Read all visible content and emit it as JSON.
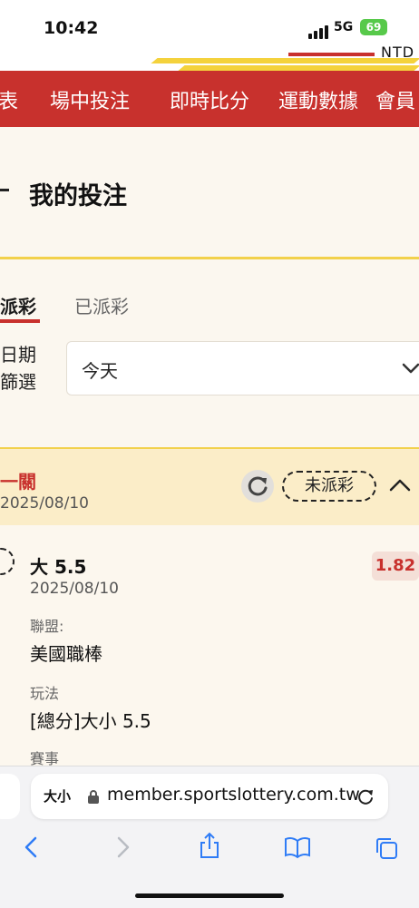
{
  "status_bar": {
    "time": "10:42",
    "network": "5G",
    "battery": "69"
  },
  "header": {
    "currency": "NTD"
  },
  "nav": {
    "items": [
      "表",
      "場中投注",
      "即時比分",
      "運動數據",
      "會員"
    ]
  },
  "page": {
    "title": "我的投注"
  },
  "tabs": {
    "unsettled": "派彩",
    "settled": "已派彩"
  },
  "filter": {
    "label_line1": "日期",
    "label_line2": "篩選",
    "selected": "今天"
  },
  "bet": {
    "type": "一關",
    "date": "2025/08/10",
    "status": "未派彩",
    "selection": "大 5.5",
    "event_date": "2025/08/10",
    "odds": "1.82",
    "league_label": "聯盟:",
    "league": "美國職棒",
    "market_label": "玩法",
    "market": "[總分]大小 5.5",
    "match_label": "賽事"
  },
  "browser": {
    "text_size": "大小",
    "url": "member.sportslottery.com.tw"
  },
  "colors": {
    "brand_red": "#c8312d",
    "accent_yellow": "#f2d14b",
    "header_bg": "#fbedc8"
  }
}
